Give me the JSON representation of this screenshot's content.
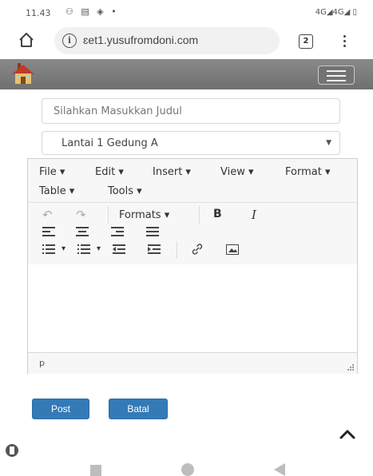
{
  "status_bar": {
    "time": "11.43",
    "icons_left": "⚇ ▤ ◈ •",
    "right_text": "4G◢4G◢ ▯"
  },
  "browser": {
    "url": "ɛet1.yusufromdoni.com",
    "tab_count": "2",
    "info_icon": "i"
  },
  "form": {
    "title_placeholder": "Silahkan Masukkan Judul",
    "location_selected": "Lantai 1 Gedung A"
  },
  "editor": {
    "menu": [
      "File",
      "Edit",
      "Insert",
      "View",
      "Format",
      "Table",
      "Tools"
    ],
    "formats_label": "Formats",
    "bold_label": "B",
    "italic_label": "I",
    "path": "p"
  },
  "buttons": {
    "post": "Post",
    "cancel": "Batal"
  },
  "colors": {
    "navbar": "#777777",
    "button_primary": "#337ab7"
  },
  "icons": [
    "home-icon",
    "info-icon",
    "tabs-icon",
    "kebab-menu-icon",
    "house-logo-icon",
    "hamburger-icon",
    "undo-icon",
    "redo-icon",
    "align-left-icon",
    "align-center-icon",
    "align-right-icon",
    "align-justify-icon",
    "bullet-list-icon",
    "numbered-list-icon",
    "outdent-icon",
    "indent-icon",
    "link-icon",
    "image-icon",
    "resize-grip-icon",
    "caret-up-icon"
  ]
}
